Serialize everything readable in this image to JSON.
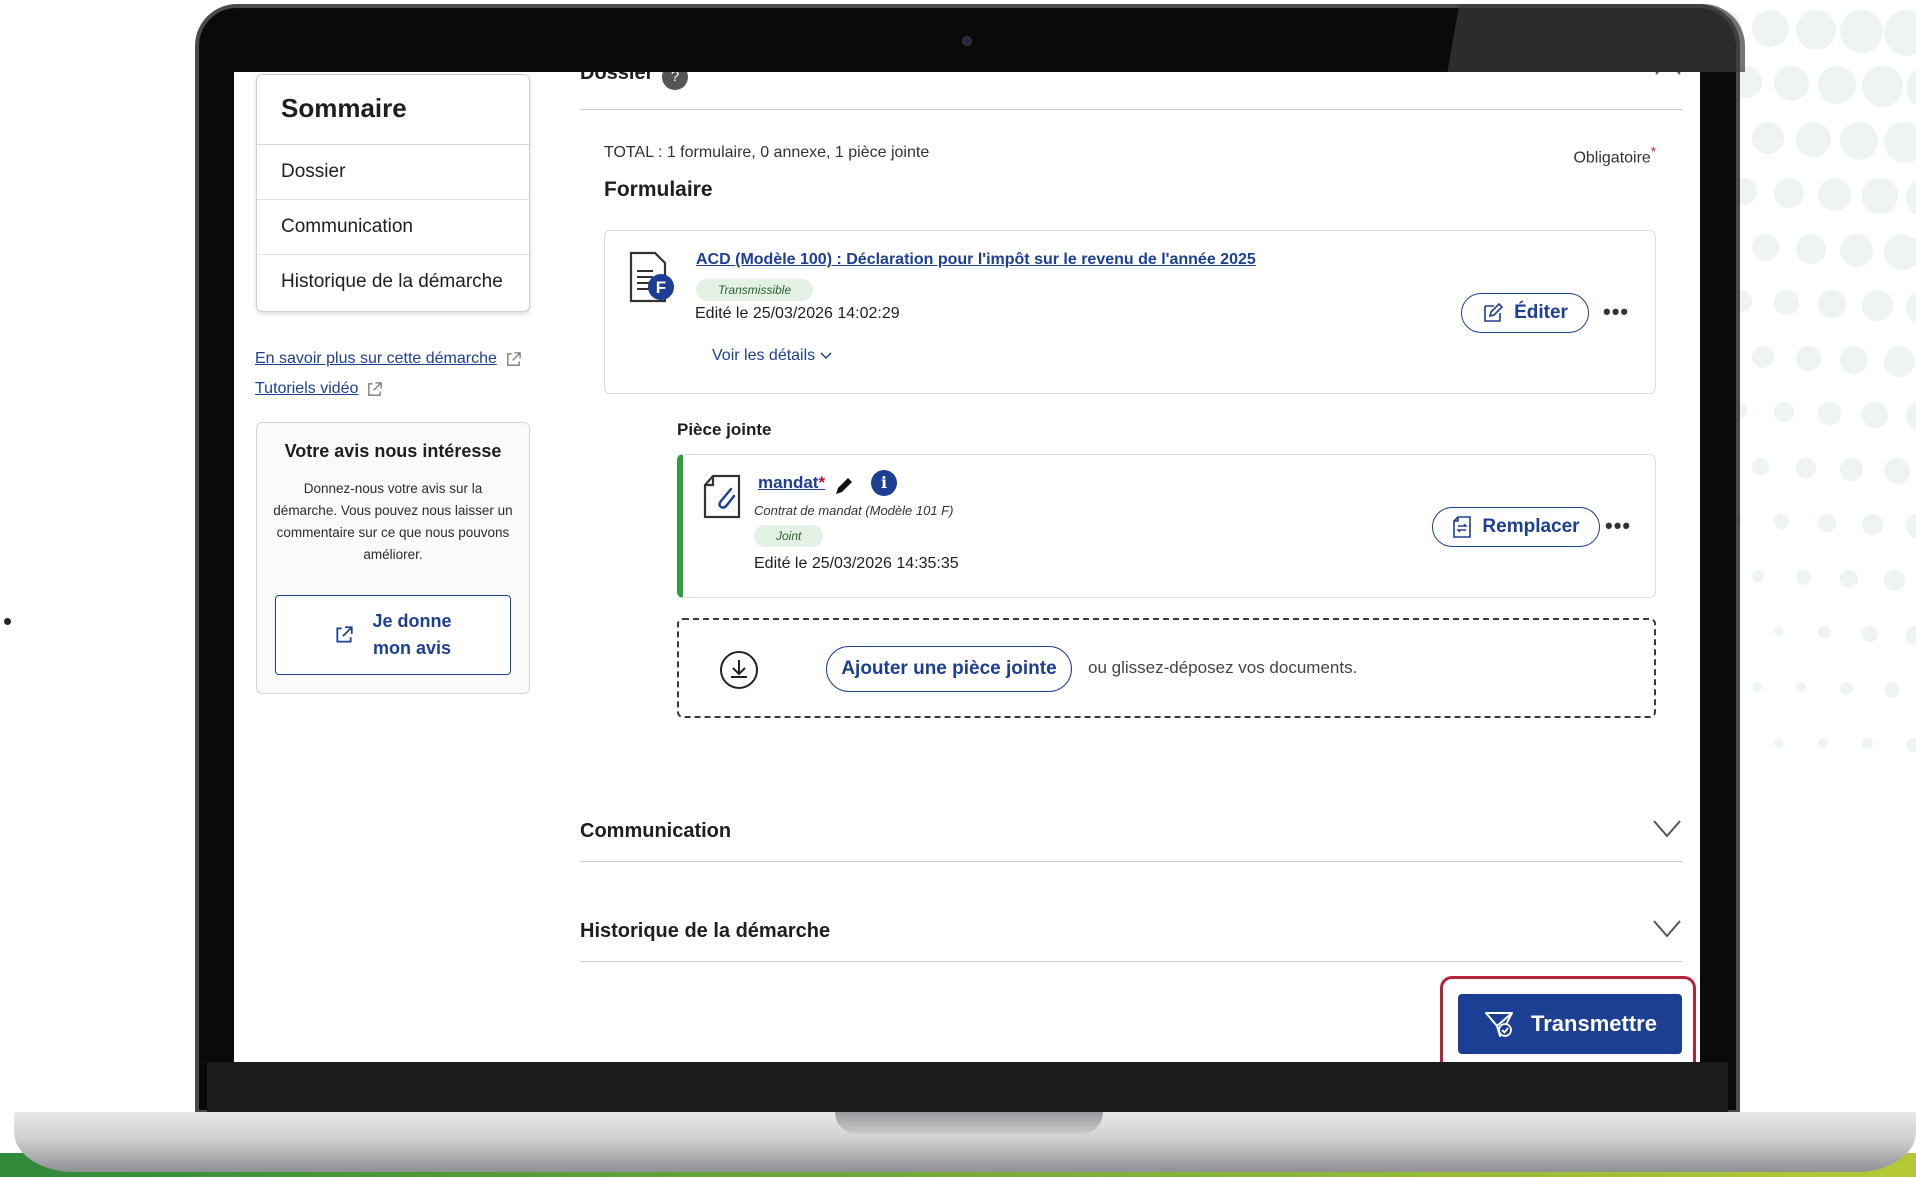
{
  "sidebar": {
    "title": "Sommaire",
    "items": [
      {
        "label": "Dossier"
      },
      {
        "label": "Communication"
      },
      {
        "label": "Historique de la démarche"
      }
    ],
    "links": [
      {
        "label": "En savoir plus sur cette démarche"
      },
      {
        "label": "Tutoriels vidéo"
      }
    ],
    "feedback": {
      "title": "Votre avis nous intéresse",
      "text": "Donnez-nous votre avis sur la démarche. Vous pouvez nous laisser un commentaire sur ce que nous pouvons améliorer.",
      "button_line1": "Je donne",
      "button_line2": "mon avis"
    }
  },
  "dossier": {
    "title": "Dossier",
    "help_icon": "?",
    "total": "TOTAL : 1 formulaire, 0 annexe, 1 pièce jointe",
    "required_label": "Obligatoire",
    "required_star": "*",
    "formulaire_heading": "Formulaire",
    "form": {
      "icon_letter": "F",
      "link": "ACD (Modèle 100) : Déclaration pour l'impôt sur le revenu de l'année 2025",
      "status": "Transmissible",
      "edited": "Edité le 25/03/2026 14:02:29",
      "details_label": "Voir les détails",
      "edit_button": "Éditer",
      "more": "•••"
    },
    "piece_heading": "Pièce jointe",
    "piece": {
      "link": "mandat",
      "star": "*",
      "info": "i",
      "subtitle": "Contrat de mandat (Modèle 101 F)",
      "status": "Joint",
      "edited": "Edité le 25/03/2026 14:35:35",
      "replace_button": "Remplacer",
      "more": "•••"
    },
    "dropzone": {
      "add_button": "Ajouter une pièce jointe",
      "text": "ou glissez-déposez vos documents."
    }
  },
  "accordions": [
    {
      "title": "Communication"
    },
    {
      "title": "Historique de la démarche"
    }
  ],
  "actions": {
    "submit": "Transmettre"
  },
  "colors": {
    "primary": "#1c3f94",
    "success": "#2e9e3a",
    "highlight": "#b3243a",
    "required": "#c8102e"
  }
}
